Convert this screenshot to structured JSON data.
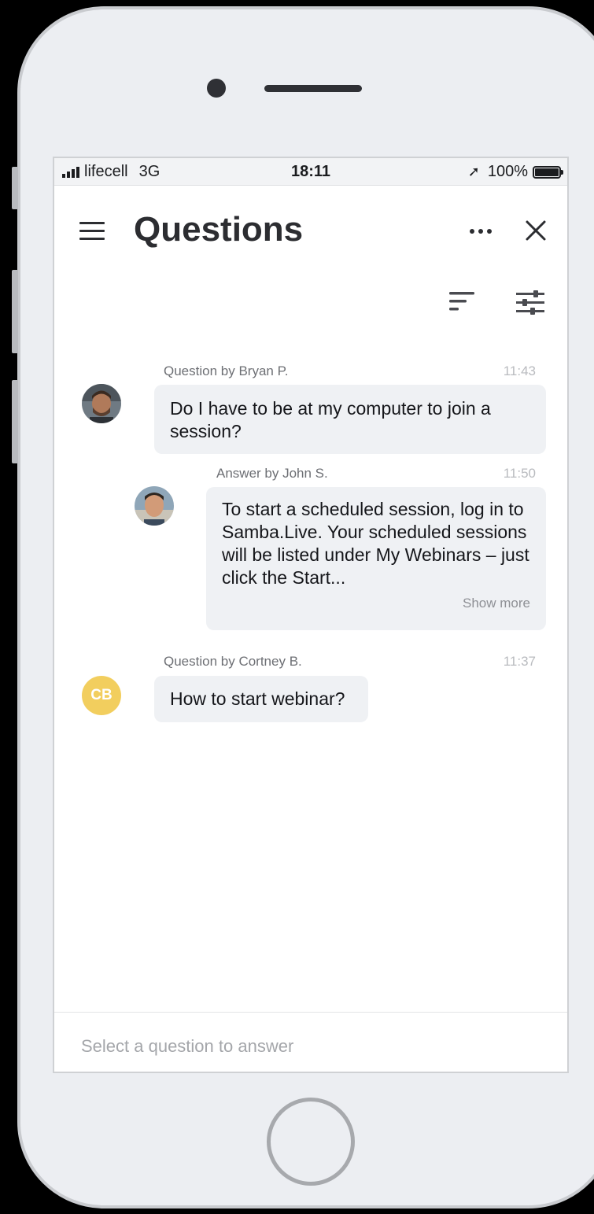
{
  "status_bar": {
    "carrier": "lifecell",
    "network": "3G",
    "time": "18:11",
    "battery": "100%"
  },
  "header": {
    "title": "Questions",
    "menu_icon": "hamburger-menu-icon",
    "more_icon": "more-dots-icon",
    "close_icon": "close-icon"
  },
  "toolbar": {
    "sort_icon": "sort-icon",
    "filter_icon": "filter-sliders-icon"
  },
  "questions": [
    {
      "meta": "Question by Bryan P.",
      "time": "11:43",
      "text": "Do I have to be at my computer to join a session?",
      "answer": {
        "meta": "Answer by John S.",
        "time": "11:50",
        "text": "To start a scheduled session, log in to Samba.Live. Your scheduled sessions will be listed under My Webinars – just click the Start...",
        "show_more": "Show more"
      }
    },
    {
      "meta": "Question by Cortney B.",
      "time": "11:37",
      "initials": "CB",
      "text": "How to start webinar?"
    }
  ],
  "footer": {
    "placeholder": "Select a question to answer"
  },
  "colors": {
    "bubble_bg": "#eff1f4",
    "avatar_cb": "#f2ce5e",
    "title": "#2c2d31"
  }
}
